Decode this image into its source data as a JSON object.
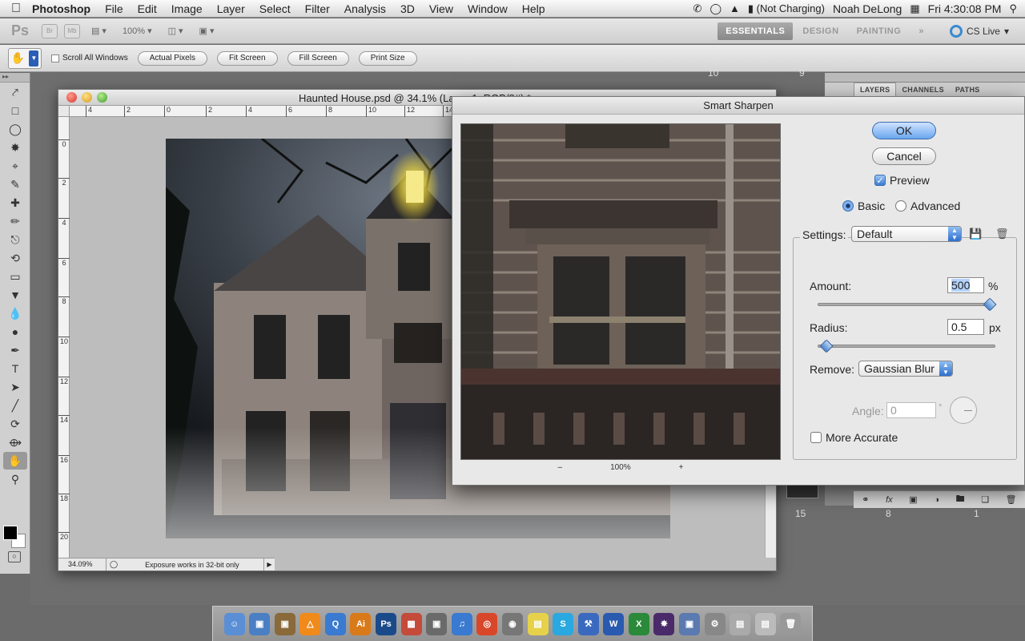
{
  "menubar": {
    "apple": "",
    "app": "Photoshop",
    "items": [
      "File",
      "Edit",
      "Image",
      "Layer",
      "Select",
      "Filter",
      "Analysis",
      "3D",
      "View",
      "Window",
      "Help"
    ],
    "battery": "(Not Charging)",
    "user": "Noah DeLong",
    "clock": "Fri 4:30:08 PM"
  },
  "appbar": {
    "logo": "Ps",
    "br": "Br",
    "mb": "Mb",
    "zoom": "100%",
    "workspaces": [
      "ESSENTIALS",
      "DESIGN",
      "PAINTING"
    ],
    "more": "»",
    "cslive": "CS Live"
  },
  "options": {
    "scroll_all": "Scroll All Windows",
    "buttons": [
      "Actual Pixels",
      "Fit Screen",
      "Fill Screen",
      "Print Size"
    ]
  },
  "document": {
    "title": "Haunted House.psd @ 34.1% (Layer 1, RGB/8#) *",
    "ruler_h": [
      "4",
      "2",
      "0",
      "2",
      "4",
      "6",
      "8",
      "10",
      "12",
      "14"
    ],
    "ruler_v": [
      "0",
      "2",
      "4",
      "6",
      "8",
      "10",
      "12",
      "14",
      "16",
      "18",
      "20"
    ],
    "status_zoom": "34.09%",
    "status_info": "Exposure works in 32-bit only"
  },
  "panels": {
    "tabs": [
      "LAYERS",
      "CHANNELS",
      "PATHS"
    ],
    "footer_icons": [
      "link-icon",
      "fx-icon",
      "mask-icon",
      "adjustment-icon",
      "folder-icon",
      "new-layer-icon",
      "trash-icon"
    ],
    "numbers": [
      "10",
      "9",
      "15",
      "8",
      "1"
    ]
  },
  "dialog": {
    "title": "Smart Sharpen",
    "ok": "OK",
    "cancel": "Cancel",
    "preview_label": "Preview",
    "preview_checked": true,
    "mode_basic": "Basic",
    "mode_advanced": "Advanced",
    "mode_selected": "Basic",
    "settings_label": "Settings:",
    "settings_value": "Default",
    "amount_label": "Amount:",
    "amount_value": "500",
    "amount_unit": "%",
    "amount_fraction": 1.0,
    "radius_label": "Radius:",
    "radius_value": "0.5",
    "radius_unit": "px",
    "radius_fraction": 0.02,
    "remove_label": "Remove:",
    "remove_value": "Gaussian Blur",
    "angle_label": "Angle:",
    "angle_value": "0",
    "angle_unit": "°",
    "more_accurate": "More Accurate",
    "zoom_minus": "–",
    "zoom_value": "100%",
    "zoom_plus": "+"
  },
  "dock": [
    "Finder",
    "Preview",
    "Photos",
    "VLC",
    "QuickTime",
    "Illustrator",
    "Photoshop",
    "Calendar",
    "Photos2",
    "iTunes",
    "Chrome",
    "Camera",
    "Stickies",
    "Skype",
    "Xcode",
    "Word",
    "Excel",
    "Bridge",
    "Preview2",
    "Sys",
    "Pics",
    "Mail",
    "Trash"
  ]
}
